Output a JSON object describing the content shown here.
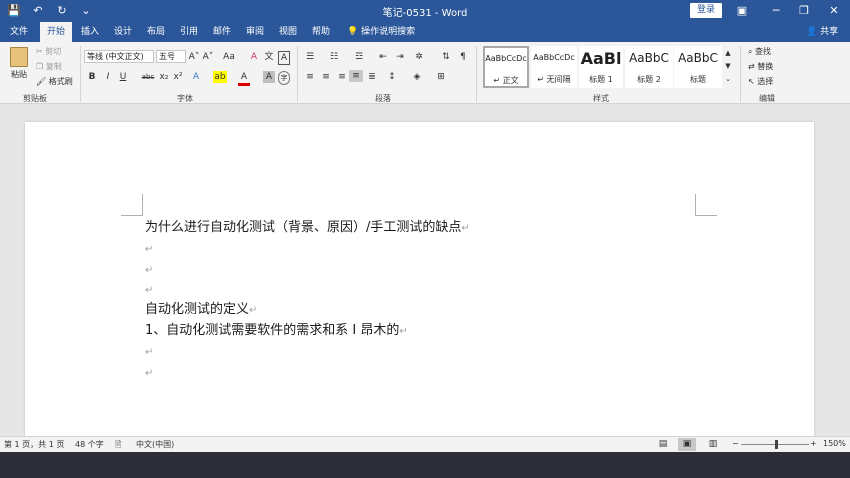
{
  "window": {
    "title": "笔记-0531 - Word",
    "login_label": "登录",
    "qat": [
      "💾",
      "↶",
      "↻",
      "⌄"
    ],
    "controls": [
      "▣",
      "─",
      "❐",
      "✕"
    ]
  },
  "tabs": [
    {
      "label": "文件"
    },
    {
      "label": "开始"
    },
    {
      "label": "插入"
    },
    {
      "label": "设计"
    },
    {
      "label": "布局"
    },
    {
      "label": "引用"
    },
    {
      "label": "邮件"
    },
    {
      "label": "审阅"
    },
    {
      "label": "视图"
    },
    {
      "label": "帮助"
    }
  ],
  "active_tab": "开始",
  "tell_me": "操作说明搜索",
  "share": "共享",
  "ribbon": {
    "clipboard": {
      "paste": "粘贴",
      "cut": "剪切",
      "copy": "复制",
      "format_painter": "格式刷",
      "label": "剪贴板"
    },
    "font": {
      "font_name": "等线 (中文正文)",
      "font_size": "五号",
      "bold": "B",
      "italic": "I",
      "underline": "U",
      "strike": "abc",
      "subscript": "x₂",
      "superscript": "x²",
      "grow": "A˄",
      "shrink": "A˅",
      "change_case": "Aa",
      "clear": "A",
      "phonetic": "文",
      "border": "A",
      "text_effect": "A",
      "highlight": "ab",
      "font_color": "A",
      "shading": "A",
      "enclose": "字",
      "label": "字体"
    },
    "paragraph": {
      "label": "段落"
    },
    "styles": {
      "items": [
        {
          "sample": "AaBbCcDc",
          "name": "↵ 正文"
        },
        {
          "sample": "AaBbCcDc",
          "name": "↵ 无间隔"
        },
        {
          "sample": "AaBl",
          "name": "标题 1"
        },
        {
          "sample": "AaBbC",
          "name": "标题 2"
        },
        {
          "sample": "AaBbC",
          "name": "标题"
        }
      ],
      "label": "样式"
    },
    "editing": {
      "find": "查找",
      "replace": "替换",
      "select": "选择",
      "label": "编辑"
    }
  },
  "document": {
    "lines": [
      "为什么进行自动化测试（背景、原因）/手工测试的缺点",
      "",
      "",
      "",
      "自动化测试的定义",
      "1、自动化测试需要软件的需求和系 I 昂木的",
      "",
      ""
    ],
    "para_mark": "↵"
  },
  "status": {
    "page": "第 1 页，共 1 页",
    "words": "48 个字",
    "language": "中文(中国)",
    "zoom": "150%",
    "zoom_minus": "−",
    "zoom_plus": "+"
  }
}
